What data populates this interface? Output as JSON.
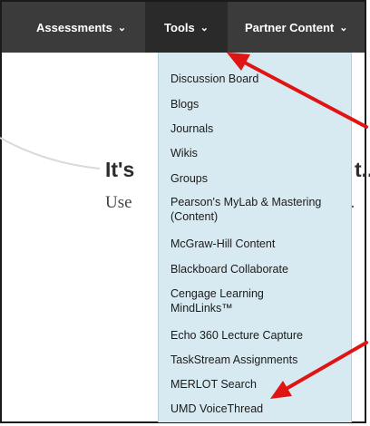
{
  "nav": {
    "assessments": "Assessments",
    "tools": "Tools",
    "partner_content": "Partner Content",
    "chevron": "⌄"
  },
  "background": {
    "heading_start": "It's",
    "heading_end": "t..",
    "sub_start": "Use",
    "sub_end": "it."
  },
  "menu": {
    "items": [
      "Discussion Board",
      "Blogs",
      "Journals",
      "Wikis",
      "Groups",
      "Pearson's MyLab & Mastering (Content)",
      "McGraw-Hill Content",
      "Blackboard Collaborate",
      "Cengage Learning MindLinks™",
      "Echo 360 Lecture Capture",
      "TaskStream Assignments",
      "MERLOT Search",
      "UMD VoiceThread"
    ]
  },
  "colors": {
    "navbar": "#3b3b3b",
    "active_tab": "#2a2a2a",
    "dropdown_bg": "#d7e9f1",
    "annotation_arrow": "#e11414"
  },
  "icons": {
    "nav_chevron": "chevron-down-icon",
    "annotation": "red-arrow-icon"
  }
}
